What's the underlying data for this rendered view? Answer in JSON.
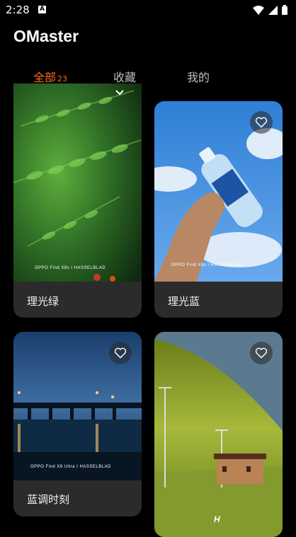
{
  "status_bar": {
    "time": "2:28",
    "notification_icon": "a-icon",
    "icons": [
      "wifi-icon",
      "signal-icon",
      "battery-icon"
    ]
  },
  "app": {
    "title": "OMaster"
  },
  "tabs": [
    {
      "label": "全部",
      "badge": "23",
      "active": true
    },
    {
      "label": "收藏",
      "active": false
    },
    {
      "label": "我的",
      "active": false
    }
  ],
  "cards": [
    {
      "label": "理光绿",
      "watermark": "OPPO Find X8s I HASSELBLAD",
      "favorite_icon": "heart-outline-icon"
    },
    {
      "label": "理光蓝",
      "watermark": "OPPO Find X8s I HASSELBLAD",
      "favorite_icon": "heart-outline-icon"
    },
    {
      "label": "蓝调时刻",
      "watermark": "OPPO Find X8 Ultra I HASSELBLAD",
      "favorite_icon": "heart-outline-icon"
    },
    {
      "label": "",
      "watermark": "H",
      "favorite_icon": "heart-outline-icon"
    }
  ],
  "colors": {
    "accent": "#ff6a1a",
    "background": "#000000",
    "card": "#2b2b2b"
  }
}
